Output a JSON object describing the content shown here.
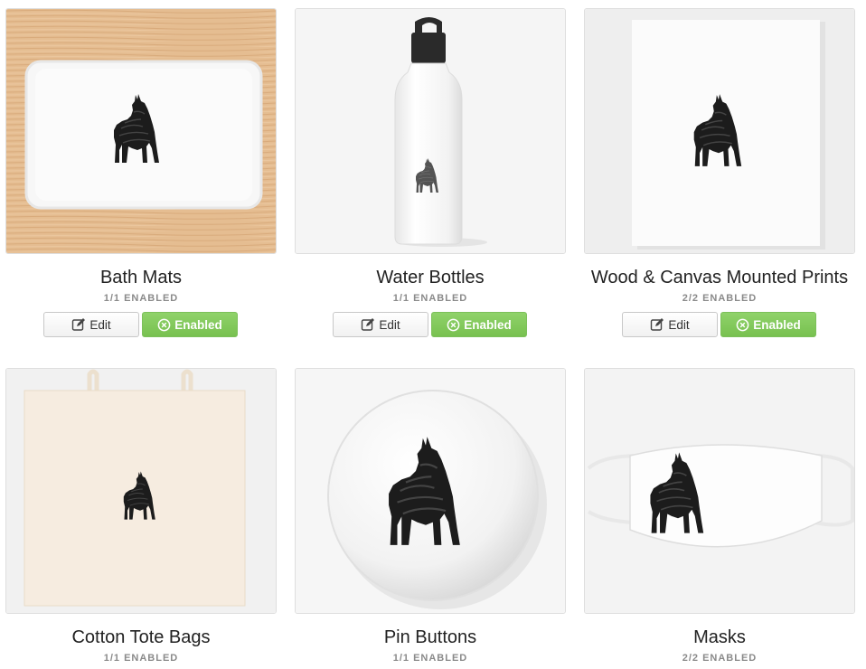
{
  "products": [
    {
      "title": "Bath Mats",
      "count": "1/1 ENABLED",
      "edit_label": "Edit",
      "status_label": "Enabled",
      "image": "bath-mat"
    },
    {
      "title": "Water Bottles",
      "count": "1/1 ENABLED",
      "edit_label": "Edit",
      "status_label": "Enabled",
      "image": "water-bottle"
    },
    {
      "title": "Wood & Canvas Mounted Prints",
      "count": "2/2 ENABLED",
      "edit_label": "Edit",
      "status_label": "Enabled",
      "image": "mounted-print"
    },
    {
      "title": "Cotton Tote Bags",
      "count": "1/1 ENABLED",
      "image": "tote-bag"
    },
    {
      "title": "Pin Buttons",
      "count": "1/1 ENABLED",
      "image": "pin-button"
    },
    {
      "title": "Masks",
      "count": "2/2 ENABLED",
      "image": "mask"
    }
  ],
  "colors": {
    "enabled_green": "#80c85a",
    "wood": "#e2b98c"
  }
}
